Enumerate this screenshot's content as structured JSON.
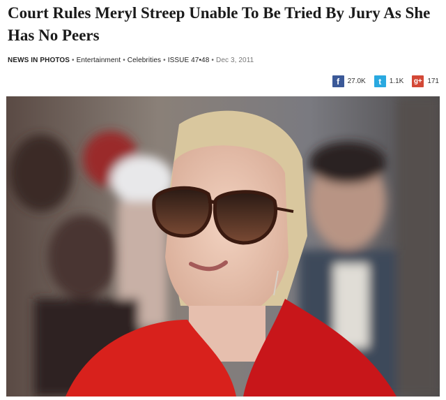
{
  "article": {
    "title": "Court Rules Meryl Streep Unable To Be Tried By Jury As She Has No Peers"
  },
  "meta": {
    "section": "NEWS IN PHOTOS",
    "category": "Entertainment",
    "subcategory": "Celebrities",
    "issue": "ISSUE 47•48",
    "date": "Dec 3, 2011",
    "separator": "•"
  },
  "share": {
    "facebook_count": "27.0K",
    "twitter_count": "1.1K",
    "googleplus_count": "171",
    "facebook_icon": "f",
    "twitter_icon": "t",
    "googleplus_icon": "g+"
  },
  "colors": {
    "facebook": "#3b5998",
    "twitter": "#2aa9e0",
    "googleplus": "#d34836"
  },
  "photo": {
    "subject": "woman-in-sunglasses-red-outfit"
  }
}
